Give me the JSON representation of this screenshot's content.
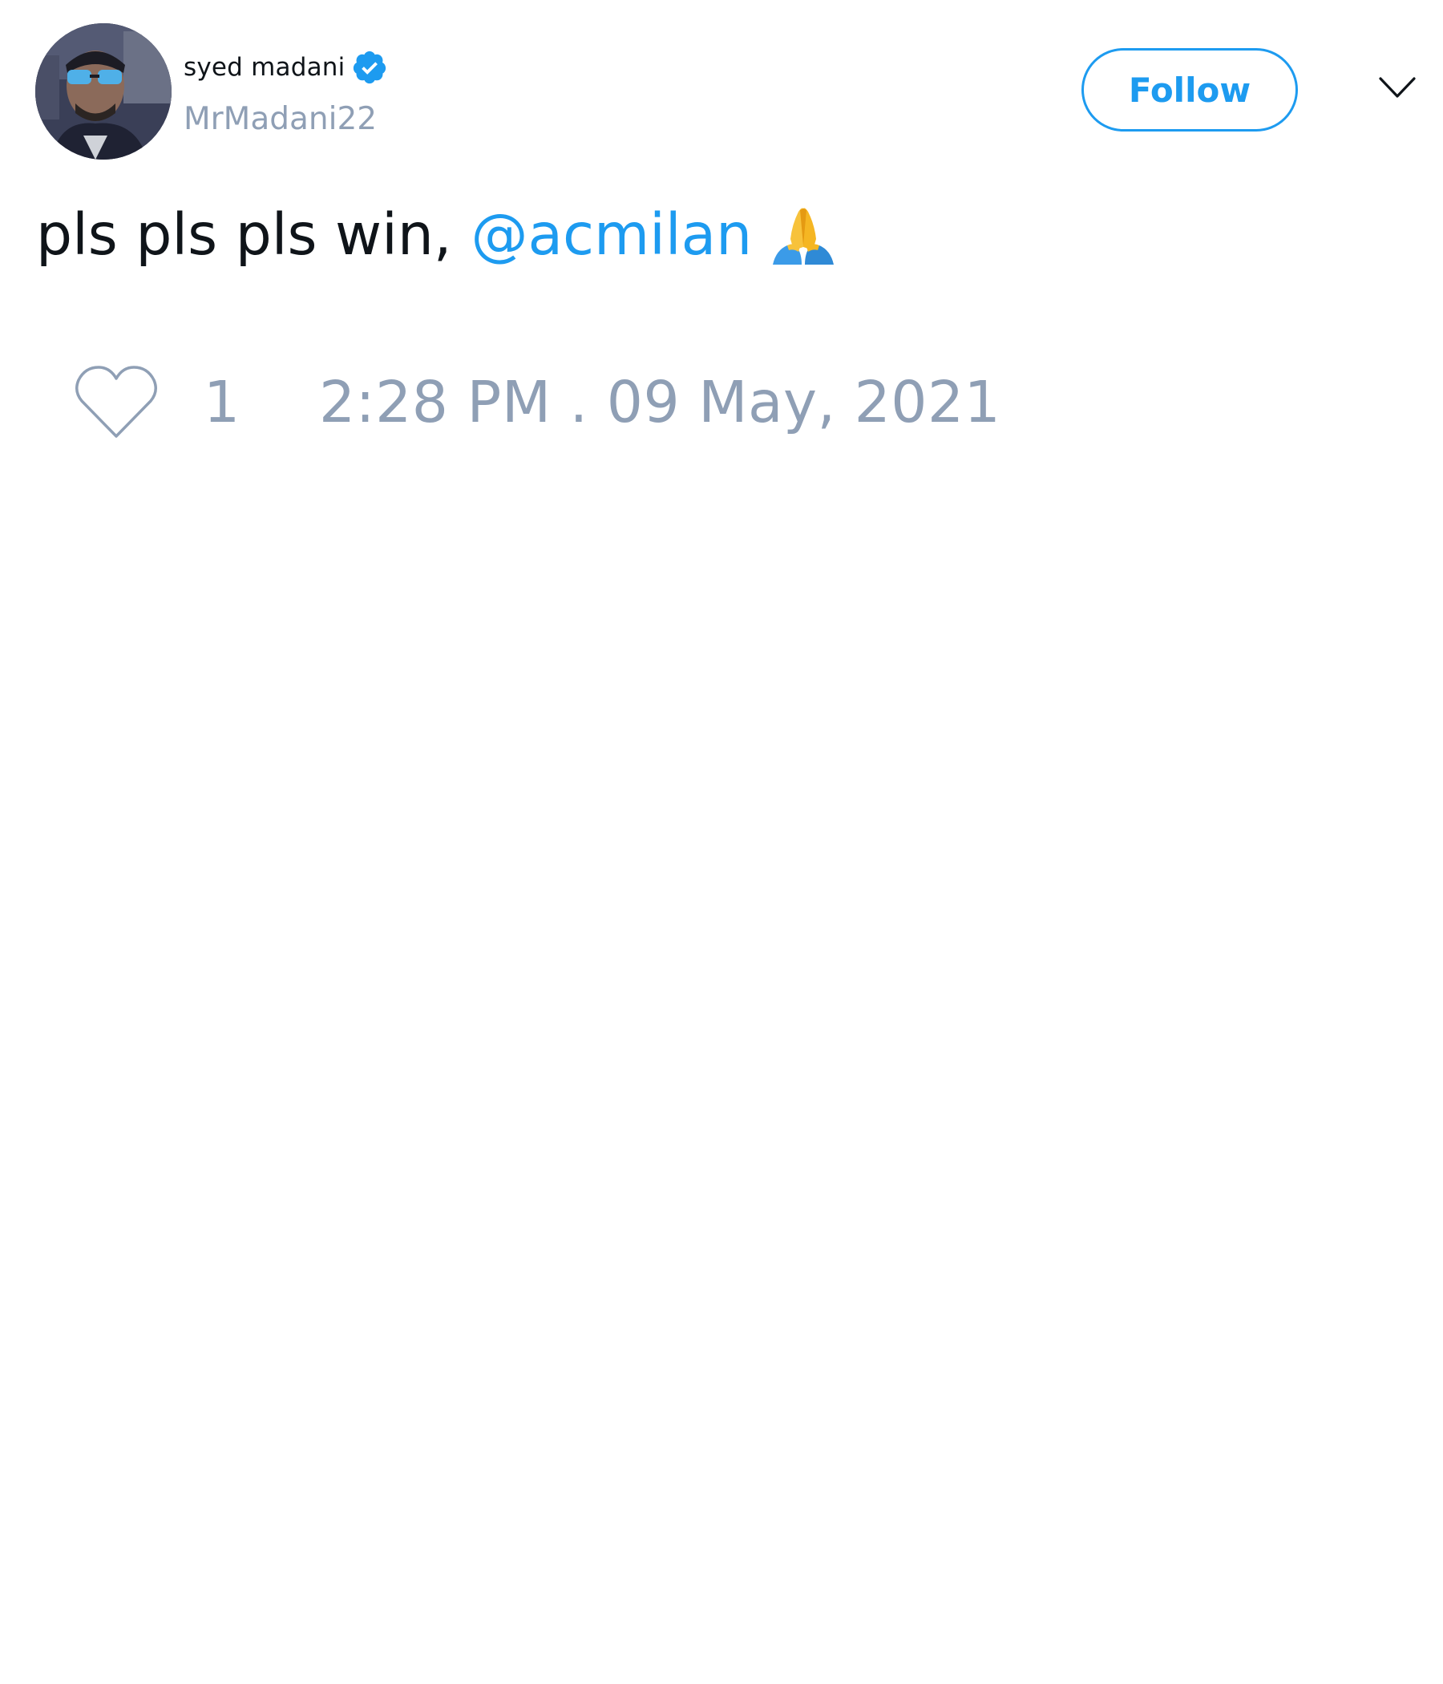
{
  "author": {
    "display_name": "syed madani",
    "handle": "MrMadani22",
    "verified": true,
    "avatar_icon": "profile-photo"
  },
  "header": {
    "follow_label": "Follow",
    "menu_icon": "chevron-down-icon"
  },
  "tweet": {
    "text_before": "pls pls pls win,",
    "mention": "@acmilan",
    "emoji_icon": "folded-hands-emoji",
    "like_icon": "heart-outline-icon",
    "like_count": "1",
    "timestamp": "2:28 PM . 09 May, 2021"
  },
  "colors": {
    "accent": "#1d9bf0",
    "muted": "#8f9fb5",
    "text": "#0f1419",
    "background": "#ffffff"
  }
}
